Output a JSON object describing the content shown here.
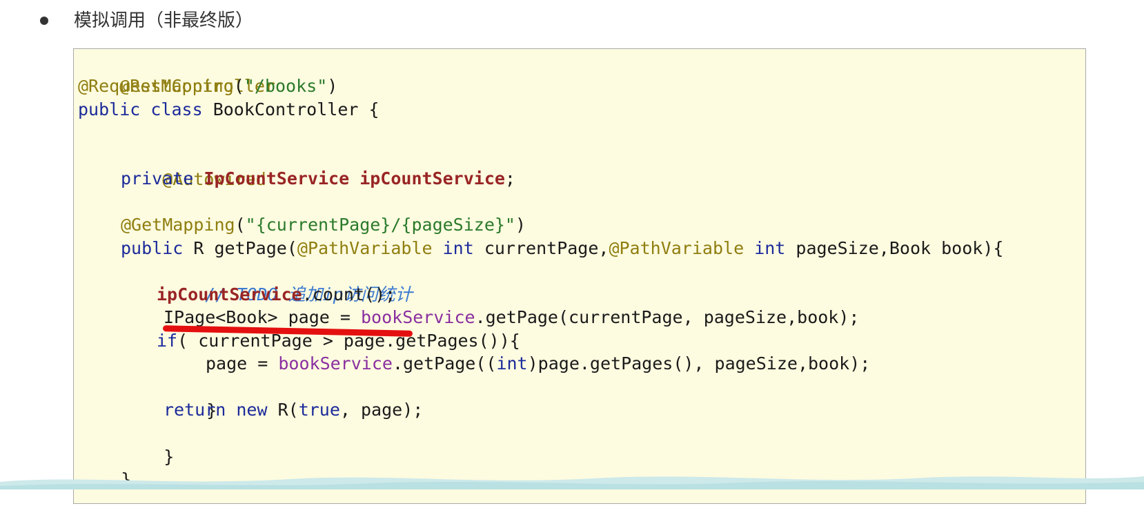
{
  "heading": {
    "text": "模拟调用（非最终版）"
  },
  "code": {
    "line1": {
      "ann": "@RestController"
    },
    "line2": {
      "ann": "@RequestMapping",
      "open": "(",
      "str": "\"/books\"",
      "close": ")"
    },
    "line3": {
      "kw1": "public",
      "kw2": "class",
      "rest": "BookController {"
    },
    "line5": {
      "ann": "@Autowired"
    },
    "line6": {
      "kw": "private",
      "type": "IpCountService",
      "field": "ipCountService",
      "end": ";"
    },
    "line8": {
      "ann": "@GetMapping",
      "open": "(",
      "str": "\"{currentPage}/{pageSize}\"",
      "close": ")"
    },
    "line9": {
      "kw1": "public",
      "t1": " R ",
      "method": "getPage",
      "p1": "(",
      "ann1": "@PathVariable",
      "kw2": "int",
      "t2": " currentPage,",
      "ann2": "@PathVariable",
      "kw3": "int",
      "t3": " pageSize,Book book){"
    },
    "line10": {
      "comment": "// TODO 追加ip访问统计"
    },
    "line11": {
      "field": "ipCountService",
      "rest": ".count();"
    },
    "line12": {
      "t1": "IPage<Book> page = ",
      "svc": "bookService",
      "t2": ".getPage(currentPage, pageSize,book);"
    },
    "line13": {
      "kw": "if",
      "rest": "( currentPage > page.getPages()){"
    },
    "line14": {
      "t1": "page = ",
      "svc": "bookService",
      "t2": ".getPage((",
      "kw": "int",
      "t3": ")page.getPages(), pageSize,book);"
    },
    "line15": {
      "text": "}"
    },
    "line16": {
      "kw1": "return",
      "kw2": "new",
      "t1": " R(",
      "kw3": "true",
      "t2": ", page);"
    },
    "line17": {
      "text": "}"
    },
    "line18": {
      "text": "}"
    }
  },
  "colors": {
    "code_background": "#fdfbe0",
    "annotation": "#8f7e10",
    "string": "#2a7a2a",
    "keyword": "#1c2b9b",
    "field": "#992525",
    "service_field": "#8a2fa0",
    "comment": "#3c7ad0",
    "highlight_strike": "#e41010"
  }
}
